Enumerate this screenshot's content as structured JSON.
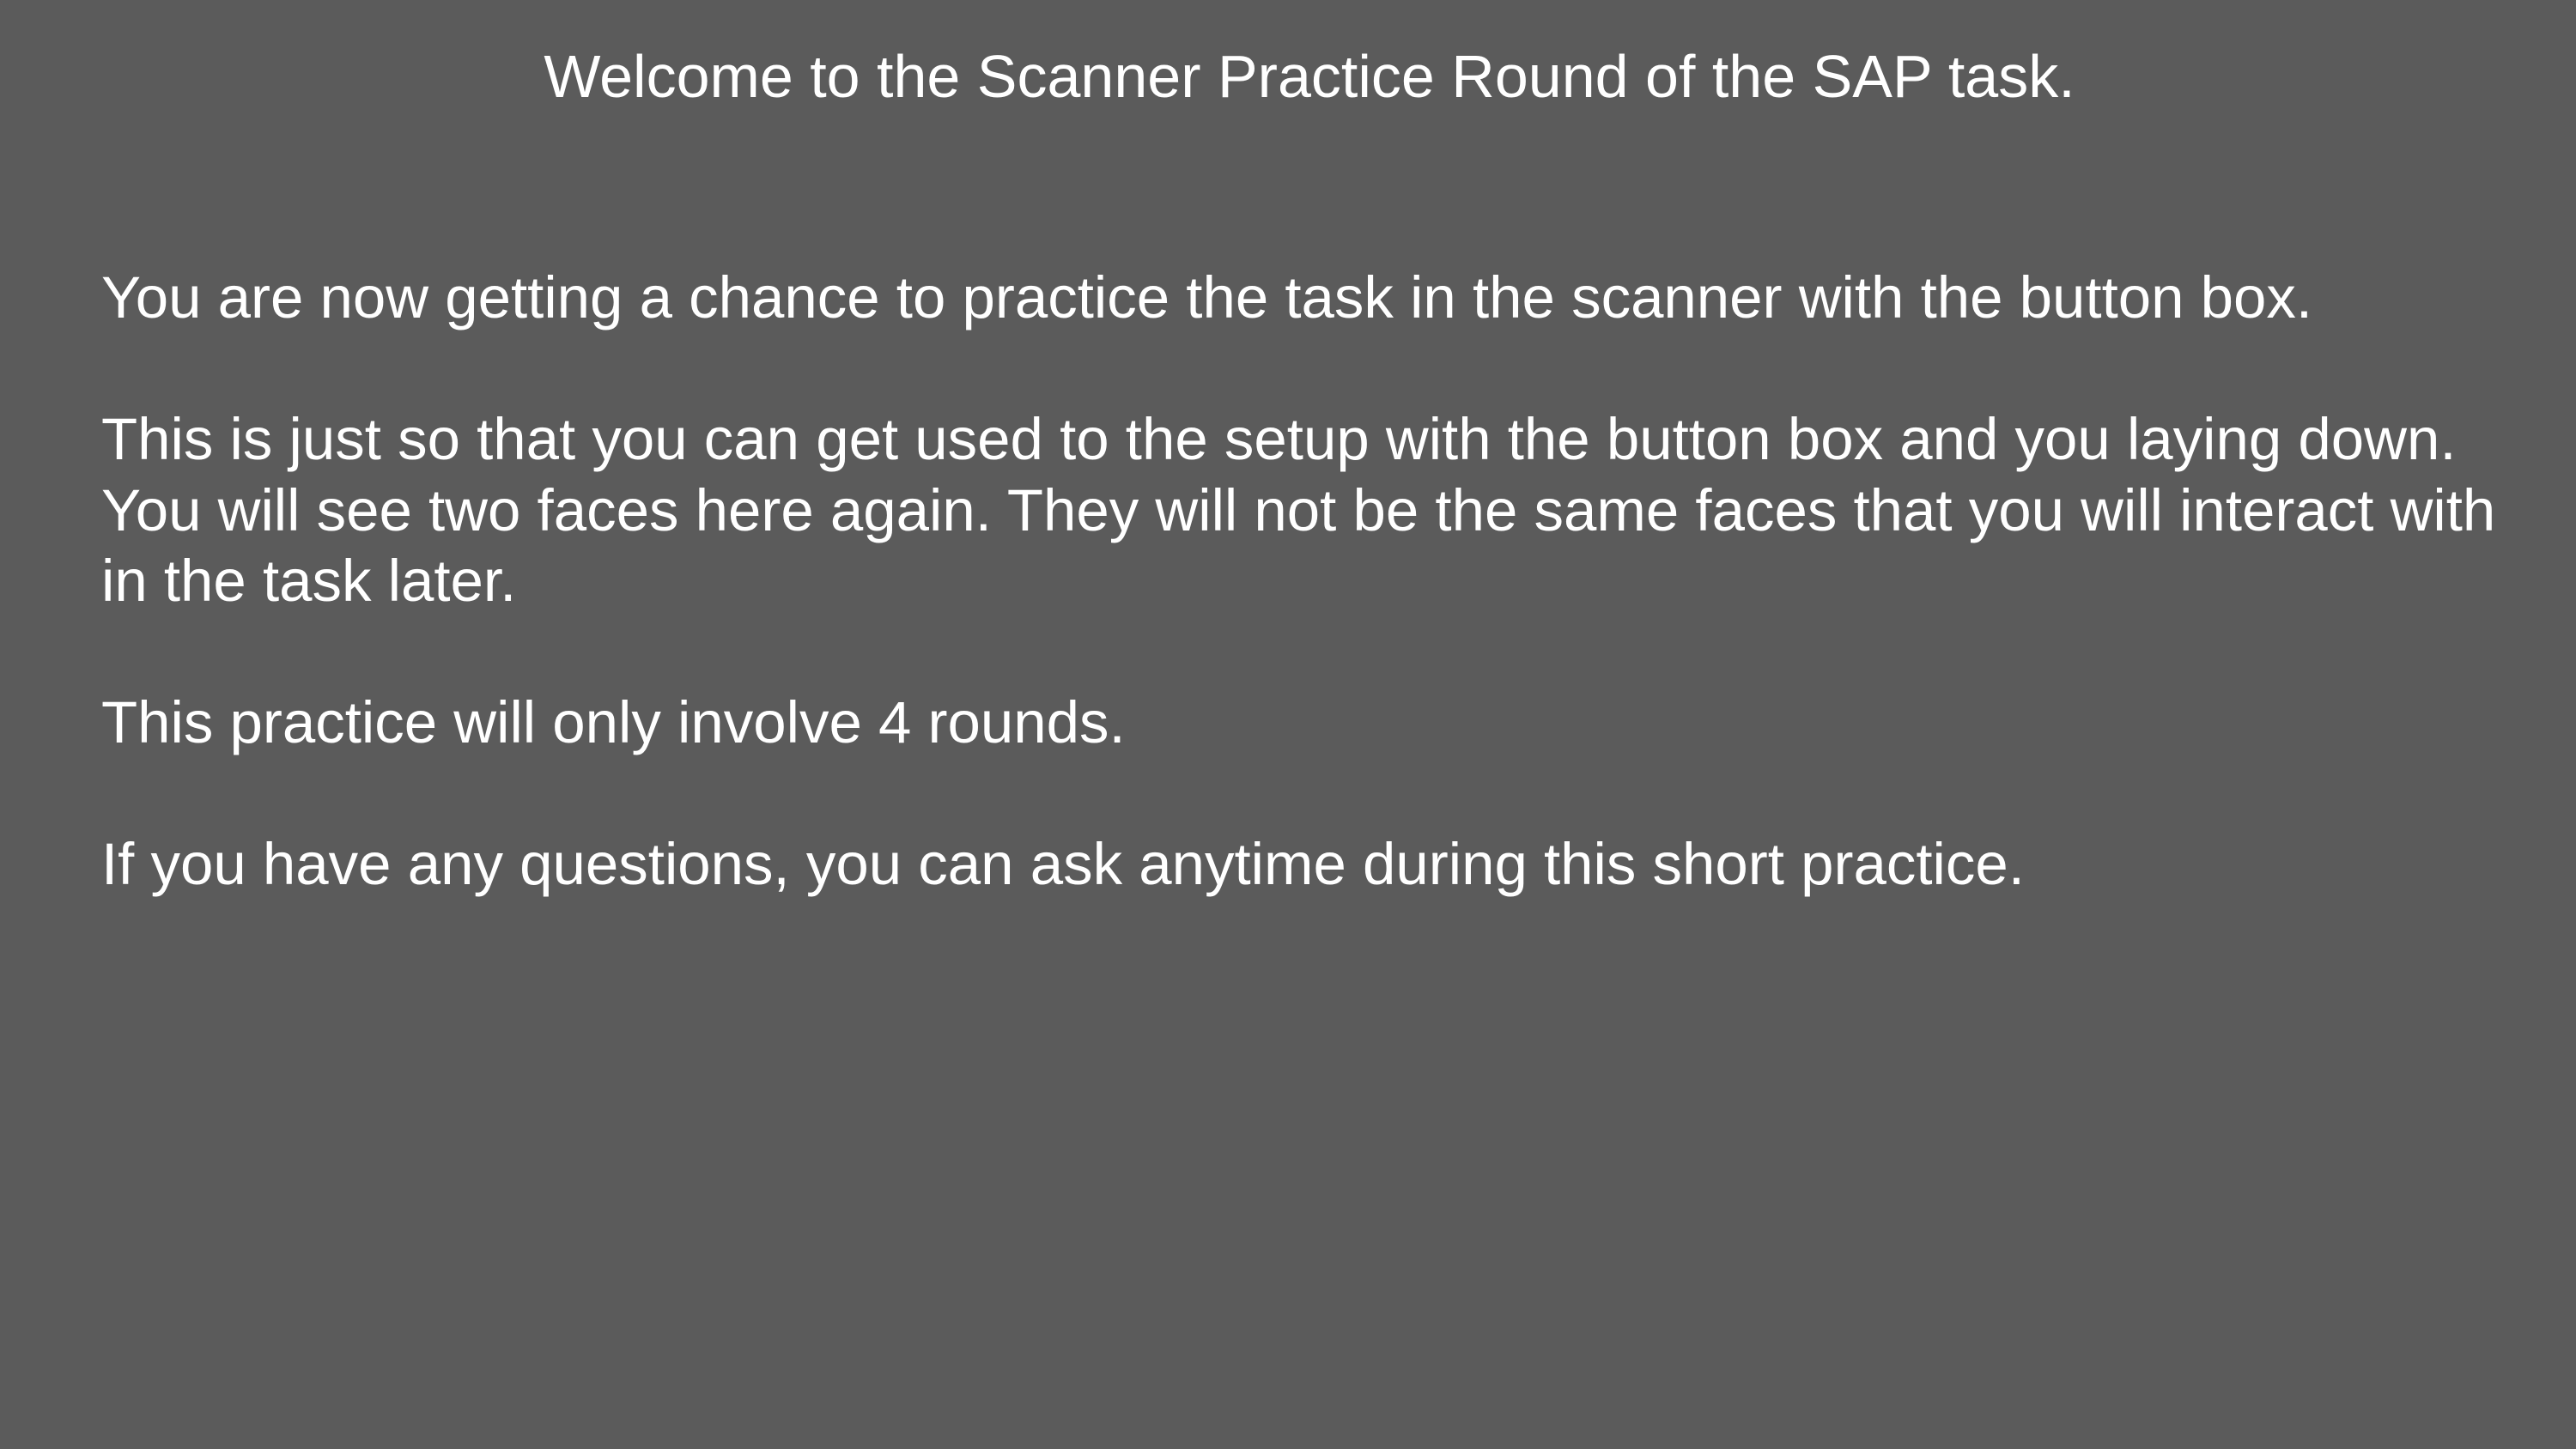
{
  "screen": {
    "background_color": "#5b5b5b",
    "text_color": "#ffffff",
    "title": "Welcome to the Scanner Practice Round of the SAP task.",
    "paragraphs": [
      {
        "lines": [
          "You are now getting a chance to practice the task in the scanner with the button box."
        ]
      },
      {
        "lines": [
          "This is just so that you can get used to the setup with the button box and you laying down.",
          "You will see two faces here again. They will not be the same faces that you will interact with",
          "in the task later."
        ]
      },
      {
        "lines": [
          "This practice will only involve 4 rounds."
        ]
      },
      {
        "lines": [
          "If you have any questions, you can ask anytime during this short practice."
        ]
      }
    ]
  }
}
